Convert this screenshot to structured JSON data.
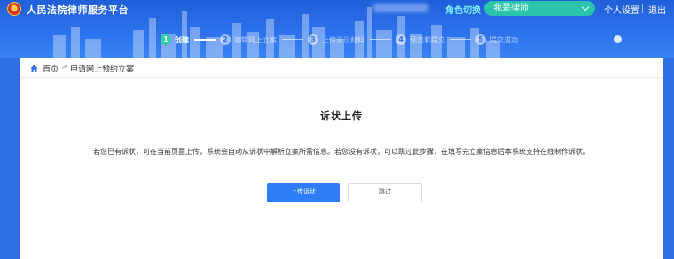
{
  "header": {
    "app_title": "人民法院律师服务平台",
    "role_switch": "角色切换",
    "role_selected": "我是律师",
    "personal_settings": "个人设置",
    "logout": "退出"
  },
  "steps": [
    {
      "num": "1",
      "label": "创建",
      "active": true
    },
    {
      "num": "2",
      "label": "编辑网上立案",
      "active": false
    },
    {
      "num": "3",
      "label": "上传诉讼材料",
      "active": false
    },
    {
      "num": "4",
      "label": "预览和提交",
      "active": false
    },
    {
      "num": "5",
      "label": "提交成功",
      "active": false
    }
  ],
  "breadcrumb": {
    "home": "首页",
    "separator": ">",
    "current": "申请网上预约立案"
  },
  "main": {
    "section_title": "诉状上传",
    "description": "若您已有诉状，可在当前页面上传，系统会自动从诉状中解析立案所需信息。若您没有诉状，可以跳过此步骤，在填写完立案信息后本系统支持在线制作诉状。",
    "upload_button": "上传诉状",
    "skip_button": "跳过"
  },
  "colors": {
    "header_blue": "#2f6fe6",
    "active_step": "#2fd1a0",
    "role_select_bg": "#29c4a9",
    "primary_button": "#2f7ef7"
  }
}
